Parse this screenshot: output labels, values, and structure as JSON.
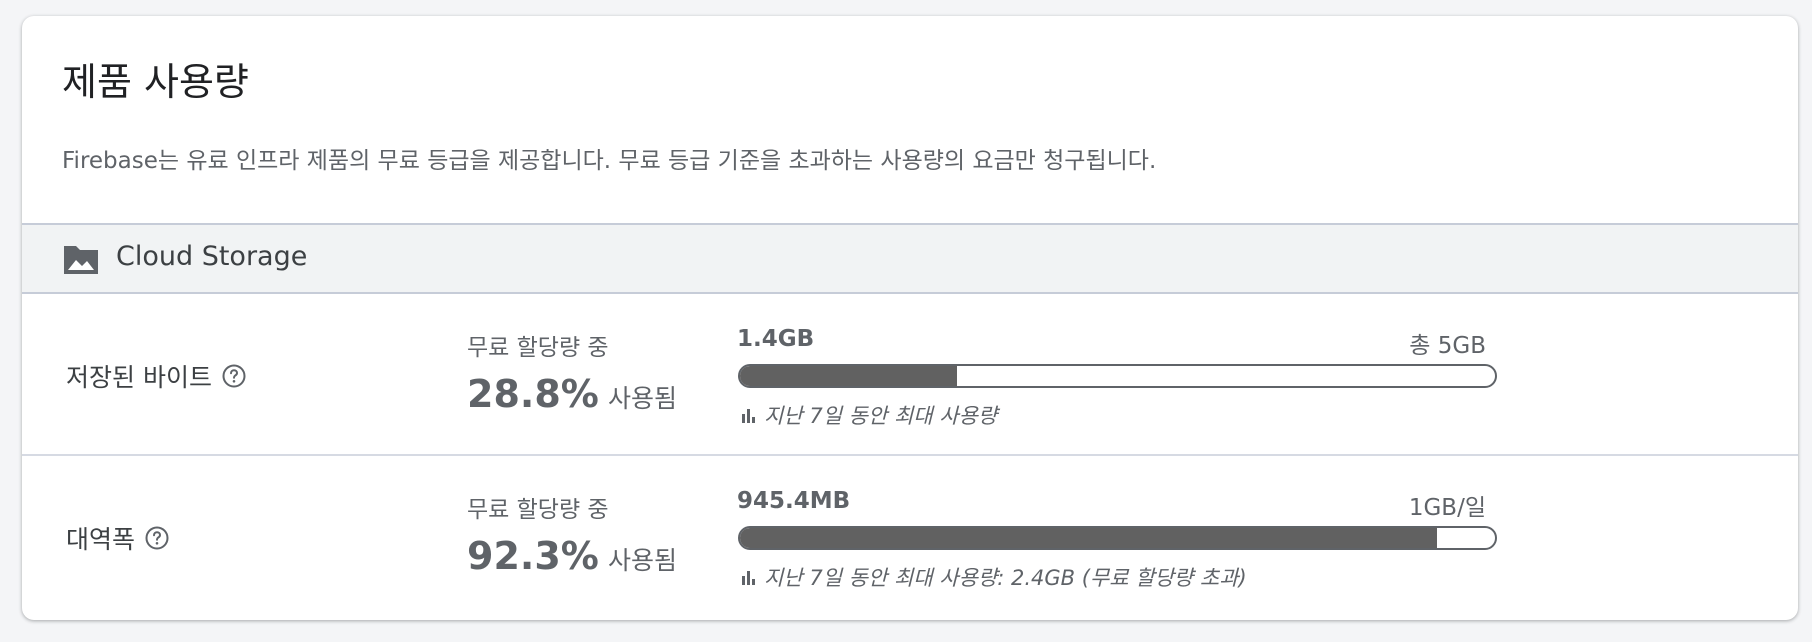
{
  "card": {
    "title": "제품 사용량",
    "description": "Firebase는 유료 인프라 제품의 무료 등급을 제공합니다. 무료 등급 기준을 초과하는 사용량의 요금만 청구됩니다."
  },
  "section": {
    "icon": "folder-image-icon",
    "title": "Cloud Storage"
  },
  "rows": [
    {
      "label": "저장된 바이트",
      "help_icon": "help-circle-icon",
      "quota_caption": "무료 할당량 중",
      "percent": "28.8%",
      "used_suffix": "사용됨",
      "used_value": "1.4GB",
      "total_value": "총 5GB",
      "fill_fraction": 0.288,
      "note_icon": "bar-chart-icon",
      "note": "지난 7일 동안 최대 사용량"
    },
    {
      "label": "대역폭",
      "help_icon": "help-circle-icon",
      "quota_caption": "무료 할당량 중",
      "percent": "92.3%",
      "used_suffix": "사용됨",
      "used_value": "945.4MB",
      "total_value": "1GB/일",
      "fill_fraction": 0.923,
      "note_icon": "bar-chart-icon",
      "note": "지난 7일 동안 최대 사용량: 2.4GB (무료 할당량 초과)"
    }
  ],
  "colors": {
    "bar_fill": "#616161",
    "section_bg": "#f1f3f4",
    "text_secondary": "#5f6368"
  }
}
